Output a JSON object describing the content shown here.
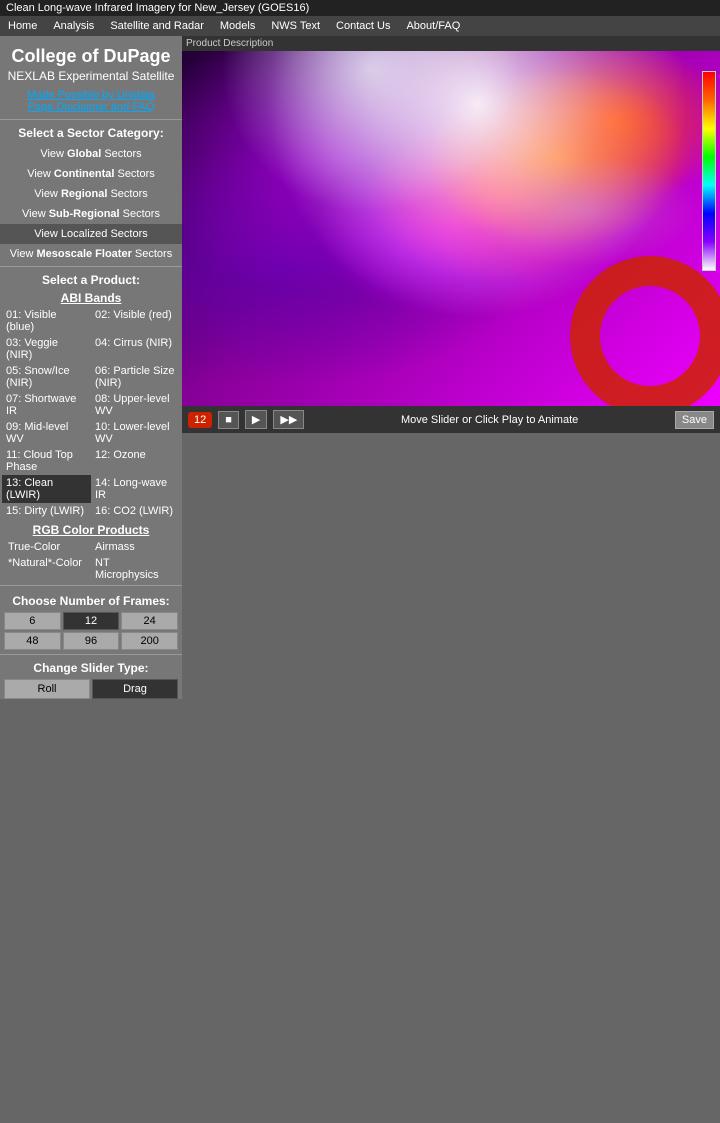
{
  "titlebar": {
    "title": "Clean Long-wave Infrared Imagery for New_Jersey (GOES16)"
  },
  "nav": {
    "items": [
      "Home",
      "Analysis",
      "Satellite and Radar",
      "Models",
      "NWS Text",
      "Contact Us",
      "About/FAQ"
    ]
  },
  "sidebar": {
    "college_name": "College of DuPage",
    "nexlab_title": "NEXLAB Experimental Satellite",
    "unidata_link": "Made Possible by Unidata",
    "disclaimer_link": "Page Disclaimer and FAQ",
    "sector_category_label": "Select a Sector Category:",
    "sector_links": [
      {
        "label": "View ",
        "bold": "Global",
        "suffix": " Sectors"
      },
      {
        "label": "View ",
        "bold": "Continental",
        "suffix": " Sectors"
      },
      {
        "label": "View ",
        "bold": "Regional",
        "suffix": " Sectors"
      },
      {
        "label": "View ",
        "bold": "Sub-Regional",
        "suffix": " Sectors"
      },
      {
        "label": "View ",
        "bold": "Localized",
        "suffix": " Sectors",
        "active": true
      },
      {
        "label": "View ",
        "bold": "Mesoscale Floater",
        "suffix": " Sectors"
      }
    ],
    "product_label": "Select a Product:",
    "abi_bands_label": "ABI Bands",
    "bands": [
      {
        "id": "01",
        "name": "Visible (blue)",
        "active": false
      },
      {
        "id": "02",
        "name": "Visible (red)",
        "active": false
      },
      {
        "id": "03",
        "name": "Veggie (NIR)",
        "active": false
      },
      {
        "id": "04",
        "name": "Cirrus (NIR)",
        "active": false
      },
      {
        "id": "05",
        "name": "Snow/Ice (NIR)",
        "active": false
      },
      {
        "id": "06",
        "name": "Particle Size (NIR)",
        "active": false
      },
      {
        "id": "07",
        "name": "Shortwave IR",
        "active": false
      },
      {
        "id": "08",
        "name": "Upper-level WV",
        "active": false
      },
      {
        "id": "09",
        "name": "Mid-level WV",
        "active": false
      },
      {
        "id": "10",
        "name": "Lower-level WV",
        "active": false
      },
      {
        "id": "11",
        "name": "Cloud Top Phase",
        "active": false
      },
      {
        "id": "12",
        "name": "Ozone",
        "active": false
      },
      {
        "id": "13",
        "name": "Clean (LWIR)",
        "active": true
      },
      {
        "id": "14",
        "name": "Long-wave IR",
        "active": false
      },
      {
        "id": "15",
        "name": "Dirty (LWIR)",
        "active": false
      },
      {
        "id": "16",
        "name": "CO2 (LWIR)",
        "active": false
      }
    ],
    "rgb_label": "RGB Color Products",
    "rgb_products": [
      {
        "name": "True-Color",
        "active": false
      },
      {
        "name": "Airmass",
        "active": false
      },
      {
        "name": "*Natural*-Color",
        "active": false
      },
      {
        "name": "NT Microphysics",
        "active": false
      }
    ],
    "frames_label": "Choose Number of Frames:",
    "frame_counts": [
      "6",
      "12",
      "24",
      "48",
      "96",
      "200"
    ],
    "active_frame": "12",
    "slider_label": "Change Slider Type:",
    "slider_options": [
      "Roll",
      "Drag"
    ],
    "active_slider": "Drag"
  },
  "image_area": {
    "header_text": "Product Description",
    "slider_text": "Move Slider or Click Play to Animate",
    "frame_counter": "12",
    "controls": {
      "stop": "■",
      "play": "▶",
      "forward": "▶▶",
      "save": "Save"
    }
  }
}
